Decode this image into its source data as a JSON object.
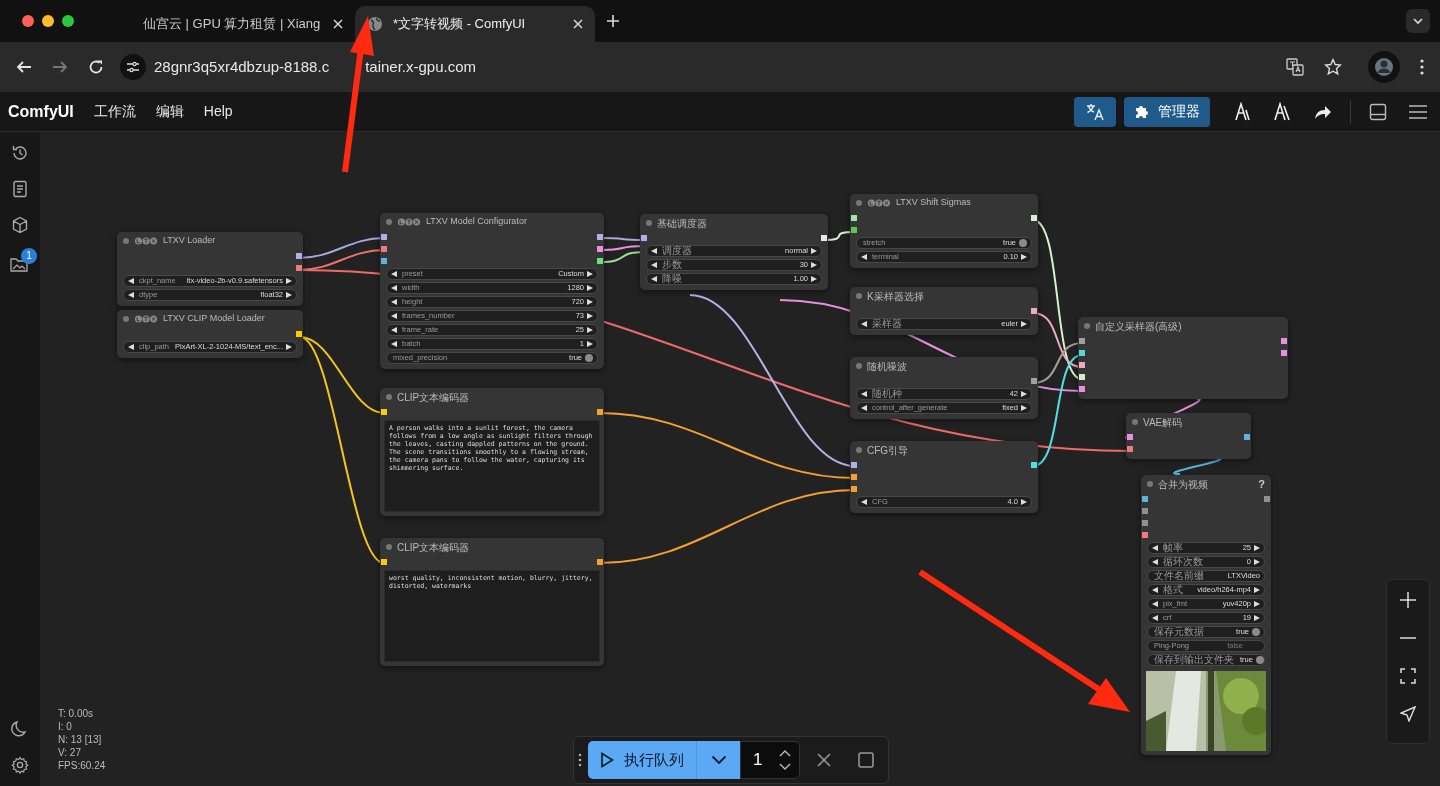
{
  "browser": {
    "tabs": [
      {
        "title": "仙宫云 | GPU 算力租赁 | Xiang",
        "selected": false
      },
      {
        "title": "*文字转视频 - ComfyUI",
        "selected": true
      }
    ],
    "address": [
      "28gnr3q5xr4dbzup-8188.c",
      "tainer.x-gpu.com"
    ]
  },
  "app": {
    "logo": "ComfyUI",
    "menu": [
      "工作流",
      "编辑",
      "Help"
    ],
    "manager_button": "管理器"
  },
  "sidebar": {
    "badge": "1"
  },
  "nodes": [
    {
      "title": "LTXV Loader",
      "kind": "ltx",
      "outputs": [
        {
          "color": "#b0b0e8"
        },
        {
          "color": "#f07a7a"
        }
      ],
      "widgets": [
        {
          "kind": "combo",
          "label": "ckpt_name",
          "value": "ltx-video-2b-v0.9.safetensors"
        },
        {
          "kind": "combo",
          "label": "dtype",
          "value": "float32"
        }
      ]
    },
    {
      "title": "LTXV CLIP Model Loader",
      "kind": "ltx",
      "outputs": [
        {
          "color": "#f5d000"
        }
      ],
      "widgets": [
        {
          "kind": "combo",
          "label": "clip_path",
          "value": "PixArt-XL-2-1024-MS/text_enc..."
        }
      ]
    },
    {
      "title": "LTXV Model Configurator",
      "kind": "ltx",
      "inputs": [
        {
          "color": "#b0b0e8"
        },
        {
          "color": "#f07a7a"
        },
        {
          "color": "#5ab4e0"
        }
      ],
      "outputs": [
        {
          "color": "#b0b0e8"
        },
        {
          "color": "#e890e0"
        },
        {
          "color": "#6ce070"
        }
      ],
      "widgets": [
        {
          "kind": "combo",
          "label": "preset",
          "value": "Custom"
        },
        {
          "kind": "combo",
          "label": "width",
          "value": "1280"
        },
        {
          "kind": "combo",
          "label": "height",
          "value": "720"
        },
        {
          "kind": "combo",
          "label": "frames_number",
          "value": "73"
        },
        {
          "kind": "combo",
          "label": "frame_rate",
          "value": "25"
        },
        {
          "kind": "combo",
          "label": "batch",
          "value": "1"
        },
        {
          "kind": "toggle",
          "label": "mixed_precision",
          "value": "true",
          "on": true
        }
      ]
    },
    {
      "title": "基础调度器",
      "kind": "plain",
      "inputs": [
        {
          "color": "#b0b0e8"
        }
      ],
      "outputs": [
        {
          "color": "#e8e8e8"
        }
      ],
      "widgets": [
        {
          "kind": "combo",
          "label": "调度器",
          "value": "normal"
        },
        {
          "kind": "combo",
          "label": "步数",
          "value": "30"
        },
        {
          "kind": "combo",
          "label": "降噪",
          "value": "1.00"
        }
      ]
    },
    {
      "title": "LTXV Shift Sigmas",
      "kind": "ltx",
      "inputs": [
        {
          "color": "#a0e8a0"
        },
        {
          "color": "#50d050"
        }
      ],
      "outputs": [
        {
          "color": "#d8f0d8"
        }
      ],
      "widgets": [
        {
          "kind": "toggle",
          "label": "stretch",
          "value": "true",
          "on": true
        },
        {
          "kind": "combo",
          "label": "terminal",
          "value": "0.10"
        }
      ]
    },
    {
      "title": "K采样器选择",
      "kind": "plain",
      "outputs": [
        {
          "color": "#f0a8c0"
        }
      ],
      "widgets": [
        {
          "kind": "combo",
          "label": "采样器",
          "value": "euler"
        }
      ]
    },
    {
      "title": "随机噪波",
      "kind": "plain",
      "outputs": [
        {
          "color": "#a0a0a0"
        }
      ],
      "widgets": [
        {
          "kind": "combo",
          "label": "随机种",
          "value": "42"
        },
        {
          "kind": "combo",
          "label": "control_after_generate",
          "value": "fixed"
        }
      ]
    },
    {
      "title": "CLIP文本编码器",
      "kind": "plain",
      "inputs": [
        {
          "color": "#f5d000"
        }
      ],
      "outputs": [
        {
          "color": "#f5a030"
        }
      ],
      "prompt": "A person walks into a sunlit forest, the camera follows from a low angle as sunlight filters through the leaves, casting dappled patterns on the ground. The scene transitions smoothly to a flowing stream, the camera pans to follow the water, capturing its shimmering surface."
    },
    {
      "title": "CLIP文本编码器",
      "kind": "plain",
      "inputs": [
        {
          "color": "#f5d000"
        }
      ],
      "outputs": [
        {
          "color": "#f5a030"
        }
      ],
      "prompt": "worst quality, inconsistent motion, blurry, jittery, distorted, watermarks"
    },
    {
      "title": "CFG引导",
      "kind": "plain",
      "inputs": [
        {
          "color": "#b0b0e8"
        },
        {
          "color": "#f5a030"
        },
        {
          "color": "#f5a030"
        }
      ],
      "outputs": [
        {
          "color": "#50e0e0"
        }
      ],
      "widgets": [
        {
          "kind": "combo",
          "label": "CFG",
          "value": "4.0"
        }
      ]
    },
    {
      "title": "自定义采样器(高级)",
      "kind": "plain",
      "inputs": [
        {
          "color": "#a0a0a0"
        },
        {
          "color": "#50d8e0"
        },
        {
          "color": "#f0a8c0"
        },
        {
          "color": "#d0f0c0"
        },
        {
          "color": "#e890e0"
        }
      ],
      "outputs": [
        {
          "color": "#e890e0"
        },
        {
          "color": "#e890e0"
        }
      ]
    },
    {
      "title": "VAE解码",
      "kind": "plain",
      "inputs": [
        {
          "color": "#e890e0"
        },
        {
          "color": "#f07a7a"
        }
      ],
      "outputs": [
        {
          "color": "#5ab4e0"
        }
      ]
    },
    {
      "title": "合并为视频",
      "kind": "plain",
      "help": "?",
      "inputs": [
        {
          "color": "#5ab4e0"
        },
        {
          "color": "#909090"
        },
        {
          "color": "#909090"
        },
        {
          "color": "#f07a7a"
        }
      ],
      "outputs": [
        {
          "color": "#909090"
        }
      ],
      "widgets": [
        {
          "kind": "combo",
          "label": "帧率",
          "value": "25"
        },
        {
          "kind": "combo",
          "label": "循环次数",
          "value": "0"
        },
        {
          "kind": "text",
          "label": "文件名前缀",
          "value": "LTXVideo"
        },
        {
          "kind": "combo",
          "label": "格式",
          "value": "video/h264-mp4"
        },
        {
          "kind": "combo",
          "label": "pix_fmt",
          "value": "yuv420p"
        },
        {
          "kind": "combo",
          "label": "crf",
          "value": "19"
        },
        {
          "kind": "toggle",
          "label": "保存元数据",
          "value": "true",
          "on": true
        },
        {
          "kind": "toggle",
          "label": "Ping-Pong",
          "value": "false",
          "on": false
        },
        {
          "kind": "toggle",
          "label": "保存到输出文件夹",
          "value": "true",
          "on": true
        }
      ],
      "preview": {
        "kind": "picture"
      }
    }
  ],
  "stats": [
    "T: 0.00s",
    "I: 0",
    "N: 13 [13]",
    "V: 27",
    "FPS:60.24"
  ],
  "queue_bar": {
    "run_button": "执行队列",
    "count": "1"
  }
}
